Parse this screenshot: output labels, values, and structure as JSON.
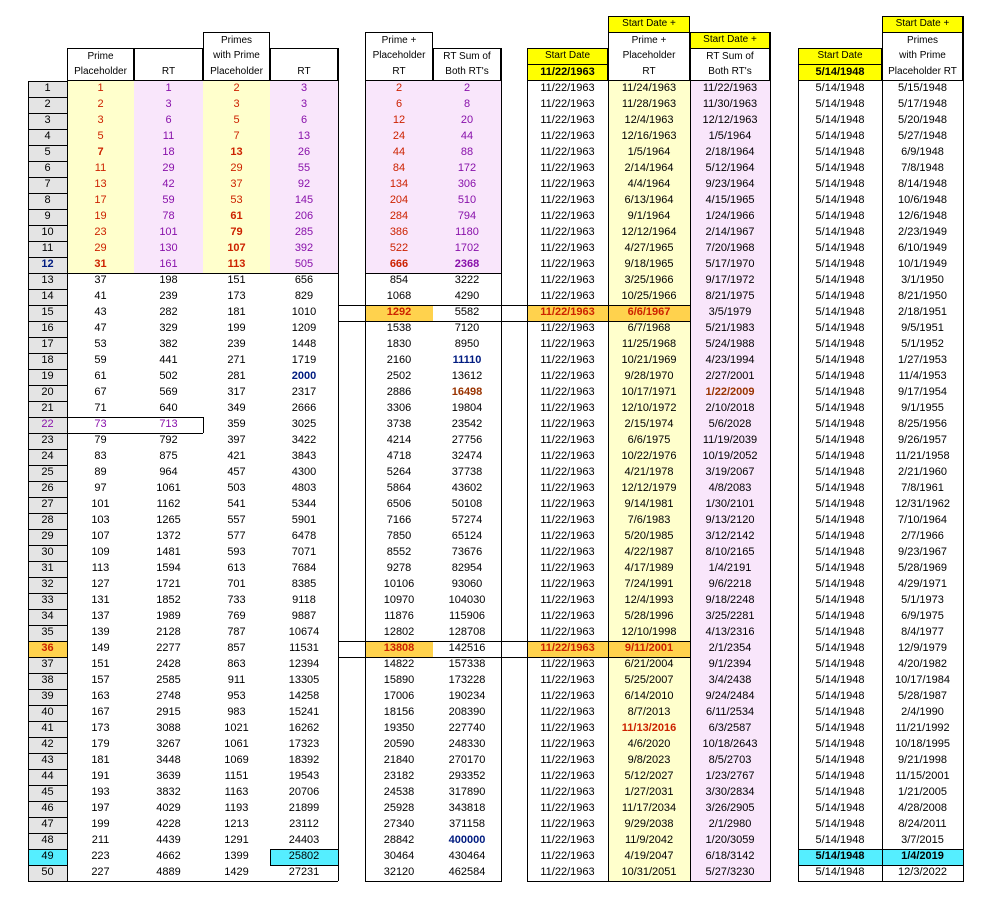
{
  "headers": {
    "prime_placeholder": [
      "Prime",
      "Placeholder"
    ],
    "rt": "RT",
    "primes_with_prime": [
      "Primes",
      "with Prime",
      "Placeholder"
    ],
    "prime_plus_placeholder_rt": [
      "Prime +",
      "Placeholder",
      "RT"
    ],
    "rt_sum_both": [
      "RT Sum of",
      "Both RT's"
    ],
    "start_date": "Start Date",
    "start_date_plus": "Start Date +",
    "date_prime_placeholder_rt": [
      "Prime +",
      "Placeholder",
      "RT"
    ],
    "date_rt_sum_both": [
      "RT Sum of",
      "Both RT's"
    ],
    "start_date_value_1": "11/22/1963",
    "start_date_value_2": "5/14/1948",
    "primes_with_prime_rt": [
      "Primes",
      "with Prime",
      "Placeholder RT"
    ]
  },
  "rows": [
    [
      "1",
      "1",
      "1",
      "2",
      "1",
      "3",
      "2",
      "2",
      "11/22/1963",
      "11/24/1963",
      "11/22/1963",
      "5/14/1948",
      "5/15/1948"
    ],
    [
      "2",
      "2",
      "3",
      "3",
      "3",
      "3",
      "6",
      "8",
      "11/22/1963",
      "11/28/1963",
      "11/30/1963",
      "5/14/1948",
      "5/17/1948"
    ],
    [
      "3",
      "3",
      "6",
      "5",
      "5",
      "6",
      "12",
      "20",
      "11/22/1963",
      "12/4/1963",
      "12/12/1963",
      "5/14/1948",
      "5/20/1948"
    ],
    [
      "4",
      "5",
      "11",
      "7",
      "7",
      "13",
      "24",
      "44",
      "11/22/1963",
      "12/16/1963",
      "1/5/1964",
      "5/14/1948",
      "5/27/1948"
    ],
    [
      "5",
      "7",
      "18",
      "13",
      "13",
      "26",
      "44",
      "88",
      "11/22/1963",
      "1/5/1964",
      "2/18/1964",
      "5/14/1948",
      "6/9/1948"
    ],
    [
      "6",
      "11",
      "29",
      "29",
      "29",
      "55",
      "84",
      "172",
      "11/22/1963",
      "2/14/1964",
      "5/12/1964",
      "5/14/1948",
      "7/8/1948"
    ],
    [
      "7",
      "13",
      "42",
      "37",
      "37",
      "92",
      "134",
      "306",
      "11/22/1963",
      "4/4/1964",
      "9/23/1964",
      "5/14/1948",
      "8/14/1948"
    ],
    [
      "8",
      "17",
      "59",
      "53",
      "53",
      "145",
      "204",
      "510",
      "11/22/1963",
      "6/13/1964",
      "4/15/1965",
      "5/14/1948",
      "10/6/1948"
    ],
    [
      "9",
      "19",
      "78",
      "61",
      "61",
      "206",
      "284",
      "794",
      "11/22/1963",
      "9/1/1964",
      "1/24/1966",
      "5/14/1948",
      "12/6/1948"
    ],
    [
      "10",
      "23",
      "101",
      "79",
      "79",
      "285",
      "386",
      "1180",
      "11/22/1963",
      "12/12/1964",
      "2/14/1967",
      "5/14/1948",
      "2/23/1949"
    ],
    [
      "11",
      "29",
      "130",
      "107",
      "107",
      "392",
      "522",
      "1702",
      "11/22/1963",
      "4/27/1965",
      "7/20/1968",
      "5/14/1948",
      "6/10/1949"
    ],
    [
      "12",
      "31",
      "161",
      "113",
      "113",
      "505",
      "666",
      "2368",
      "11/22/1963",
      "9/18/1965",
      "5/17/1970",
      "5/14/1948",
      "10/1/1949"
    ],
    [
      "13",
      "37",
      "198",
      "151",
      "151",
      "656",
      "854",
      "3222",
      "11/22/1963",
      "3/25/1966",
      "9/17/1972",
      "5/14/1948",
      "3/1/1950"
    ],
    [
      "14",
      "41",
      "239",
      "173",
      "173",
      "829",
      "1068",
      "4290",
      "11/22/1963",
      "10/25/1966",
      "8/21/1975",
      "5/14/1948",
      "8/21/1950"
    ],
    [
      "15",
      "43",
      "282",
      "181",
      "181",
      "1010",
      "1292",
      "5582",
      "11/22/1963",
      "6/6/1967",
      "3/5/1979",
      "5/14/1948",
      "2/18/1951"
    ],
    [
      "16",
      "47",
      "329",
      "199",
      "199",
      "1209",
      "1538",
      "7120",
      "11/22/1963",
      "6/7/1968",
      "5/21/1983",
      "5/14/1948",
      "9/5/1951"
    ],
    [
      "17",
      "53",
      "382",
      "239",
      "239",
      "1448",
      "1830",
      "8950",
      "11/22/1963",
      "11/25/1968",
      "5/24/1988",
      "5/14/1948",
      "5/1/1952"
    ],
    [
      "18",
      "59",
      "441",
      "271",
      "271",
      "1719",
      "2160",
      "11110",
      "11/22/1963",
      "10/21/1969",
      "4/23/1994",
      "5/14/1948",
      "1/27/1953"
    ],
    [
      "19",
      "61",
      "502",
      "281",
      "281",
      "2000",
      "2502",
      "13612",
      "11/22/1963",
      "9/28/1970",
      "2/27/2001",
      "5/14/1948",
      "11/4/1953"
    ],
    [
      "20",
      "67",
      "569",
      "317",
      "317",
      "2317",
      "2886",
      "16498",
      "11/22/1963",
      "10/17/1971",
      "1/22/2009",
      "5/14/1948",
      "9/17/1954"
    ],
    [
      "21",
      "71",
      "640",
      "349",
      "349",
      "2666",
      "3306",
      "19804",
      "11/22/1963",
      "12/10/1972",
      "2/10/2018",
      "5/14/1948",
      "9/1/1955"
    ],
    [
      "22",
      "73",
      "713",
      "359",
      "359",
      "3025",
      "3738",
      "23542",
      "11/22/1963",
      "2/15/1974",
      "5/6/2028",
      "5/14/1948",
      "8/25/1956"
    ],
    [
      "23",
      "79",
      "792",
      "397",
      "397",
      "3422",
      "4214",
      "27756",
      "11/22/1963",
      "6/6/1975",
      "11/19/2039",
      "5/14/1948",
      "9/26/1957"
    ],
    [
      "24",
      "83",
      "875",
      "421",
      "421",
      "3843",
      "4718",
      "32474",
      "11/22/1963",
      "10/22/1976",
      "10/19/2052",
      "5/14/1948",
      "11/21/1958"
    ],
    [
      "25",
      "89",
      "964",
      "457",
      "457",
      "4300",
      "5264",
      "37738",
      "11/22/1963",
      "4/21/1978",
      "3/19/2067",
      "5/14/1948",
      "2/21/1960"
    ],
    [
      "26",
      "97",
      "1061",
      "503",
      "503",
      "4803",
      "5864",
      "43602",
      "11/22/1963",
      "12/12/1979",
      "4/8/2083",
      "5/14/1948",
      "7/8/1961"
    ],
    [
      "27",
      "101",
      "1162",
      "541",
      "541",
      "5344",
      "6506",
      "50108",
      "11/22/1963",
      "9/14/1981",
      "1/30/2101",
      "5/14/1948",
      "12/31/1962"
    ],
    [
      "28",
      "103",
      "1265",
      "557",
      "557",
      "5901",
      "7166",
      "57274",
      "11/22/1963",
      "7/6/1983",
      "9/13/2120",
      "5/14/1948",
      "7/10/1964"
    ],
    [
      "29",
      "107",
      "1372",
      "577",
      "577",
      "6478",
      "7850",
      "65124",
      "11/22/1963",
      "5/20/1985",
      "3/12/2142",
      "5/14/1948",
      "2/7/1966"
    ],
    [
      "30",
      "109",
      "1481",
      "593",
      "593",
      "7071",
      "8552",
      "73676",
      "11/22/1963",
      "4/22/1987",
      "8/10/2165",
      "5/14/1948",
      "9/23/1967"
    ],
    [
      "31",
      "113",
      "1594",
      "613",
      "613",
      "7684",
      "9278",
      "82954",
      "11/22/1963",
      "4/17/1989",
      "1/4/2191",
      "5/14/1948",
      "5/28/1969"
    ],
    [
      "32",
      "127",
      "1721",
      "701",
      "701",
      "8385",
      "10106",
      "93060",
      "11/22/1963",
      "7/24/1991",
      "9/6/2218",
      "5/14/1948",
      "4/29/1971"
    ],
    [
      "33",
      "131",
      "1852",
      "733",
      "733",
      "9118",
      "10970",
      "104030",
      "11/22/1963",
      "12/4/1993",
      "9/18/2248",
      "5/14/1948",
      "5/1/1973"
    ],
    [
      "34",
      "137",
      "1989",
      "769",
      "769",
      "9887",
      "11876",
      "115906",
      "11/22/1963",
      "5/28/1996",
      "3/25/2281",
      "5/14/1948",
      "6/9/1975"
    ],
    [
      "35",
      "139",
      "2128",
      "787",
      "787",
      "10674",
      "12802",
      "128708",
      "11/22/1963",
      "12/10/1998",
      "4/13/2316",
      "5/14/1948",
      "8/4/1977"
    ],
    [
      "36",
      "149",
      "2277",
      "857",
      "857",
      "11531",
      "13808",
      "142516",
      "11/22/1963",
      "9/11/2001",
      "2/1/2354",
      "5/14/1948",
      "12/9/1979"
    ],
    [
      "37",
      "151",
      "2428",
      "863",
      "863",
      "12394",
      "14822",
      "157338",
      "11/22/1963",
      "6/21/2004",
      "9/1/2394",
      "5/14/1948",
      "4/20/1982"
    ],
    [
      "38",
      "157",
      "2585",
      "911",
      "911",
      "13305",
      "15890",
      "173228",
      "11/22/1963",
      "5/25/2007",
      "3/4/2438",
      "5/14/1948",
      "10/17/1984"
    ],
    [
      "39",
      "163",
      "2748",
      "953",
      "953",
      "14258",
      "17006",
      "190234",
      "11/22/1963",
      "6/14/2010",
      "9/24/2484",
      "5/14/1948",
      "5/28/1987"
    ],
    [
      "40",
      "167",
      "2915",
      "983",
      "983",
      "15241",
      "18156",
      "208390",
      "11/22/1963",
      "8/7/2013",
      "6/11/2534",
      "5/14/1948",
      "2/4/1990"
    ],
    [
      "41",
      "173",
      "3088",
      "1021",
      "1021",
      "16262",
      "19350",
      "227740",
      "11/22/1963",
      "11/13/2016",
      "6/3/2587",
      "5/14/1948",
      "11/21/1992"
    ],
    [
      "42",
      "179",
      "3267",
      "1061",
      "1061",
      "17323",
      "20590",
      "248330",
      "11/22/1963",
      "4/6/2020",
      "10/18/2643",
      "5/14/1948",
      "10/18/1995"
    ],
    [
      "43",
      "181",
      "3448",
      "1069",
      "1069",
      "18392",
      "21840",
      "270170",
      "11/22/1963",
      "9/8/2023",
      "8/5/2703",
      "5/14/1948",
      "9/21/1998"
    ],
    [
      "44",
      "191",
      "3639",
      "1151",
      "1151",
      "19543",
      "23182",
      "293352",
      "11/22/1963",
      "5/12/2027",
      "1/23/2767",
      "5/14/1948",
      "11/15/2001"
    ],
    [
      "45",
      "193",
      "3832",
      "1163",
      "1163",
      "20706",
      "24538",
      "317890",
      "11/22/1963",
      "1/27/2031",
      "3/30/2834",
      "5/14/1948",
      "1/21/2005"
    ],
    [
      "46",
      "197",
      "4029",
      "1193",
      "1193",
      "21899",
      "25928",
      "343818",
      "11/22/1963",
      "11/17/2034",
      "3/26/2905",
      "5/14/1948",
      "4/28/2008"
    ],
    [
      "47",
      "199",
      "4228",
      "1213",
      "1213",
      "23112",
      "27340",
      "371158",
      "11/22/1963",
      "9/29/2038",
      "2/1/2980",
      "5/14/1948",
      "8/24/2011"
    ],
    [
      "48",
      "211",
      "4439",
      "1291",
      "1291",
      "24403",
      "28842",
      "400000",
      "11/22/1963",
      "11/9/2042",
      "1/20/3059",
      "5/14/1948",
      "3/7/2015"
    ],
    [
      "49",
      "223",
      "4662",
      "1399",
      "1399",
      "25802",
      "30464",
      "430464",
      "11/22/1963",
      "4/19/2047",
      "6/18/3142",
      "5/14/1948",
      "1/4/2019"
    ],
    [
      "50",
      "227",
      "4889",
      "1429",
      "1429",
      "27231",
      "32120",
      "462584",
      "11/22/1963",
      "10/31/2051",
      "5/27/3230",
      "5/14/1948",
      "12/3/2022"
    ]
  ],
  "colors": {
    "yellow": "#ffff00",
    "light_yellow": "#ffffcc",
    "light_purple": "#f9e6fb",
    "cyan": "#55eeff",
    "red": "#cc2200",
    "purple": "#8811aa",
    "navy": "#001b80"
  }
}
